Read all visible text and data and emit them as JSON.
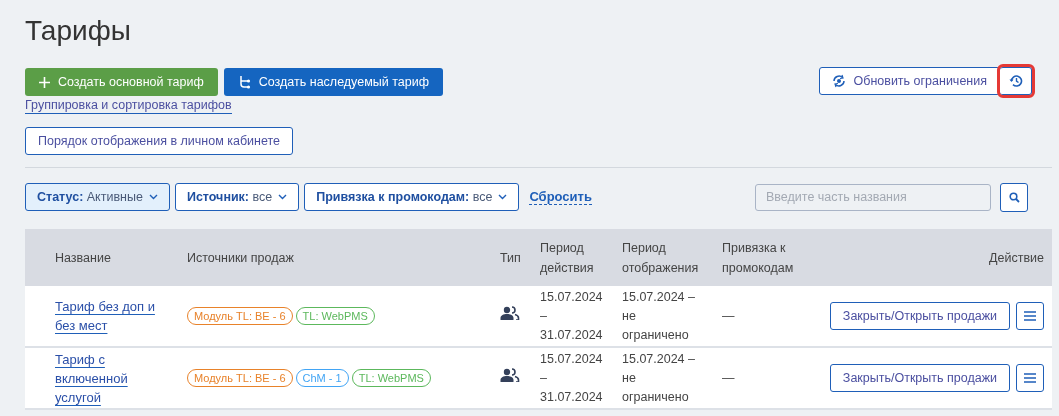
{
  "title": "Тарифы",
  "primary_buttons": [
    {
      "label": "Создать основной тариф",
      "kind": "plus"
    },
    {
      "label": "Создать наследуемый тариф",
      "kind": "branch"
    }
  ],
  "grouping_link": "Группировка и сортировка тарифов",
  "order_button": "Порядок отображения в личном кабинете",
  "refresh_button": "Обновить ограничения",
  "history_button": {
    "highlighted": true
  },
  "filters": [
    {
      "label": "Статус:",
      "value": "Активные",
      "selected": true
    },
    {
      "label": "Источник:",
      "value": "все",
      "selected": false
    },
    {
      "label": "Привязка к промокодам:",
      "value": "все",
      "selected": false
    }
  ],
  "reset_link": "Сбросить",
  "search": {
    "placeholder": "Введите часть названия"
  },
  "table": {
    "columns": [
      "Название",
      "Источники продаж",
      "Тип",
      "Период действия",
      "Период отображения",
      "Привязка к промокодам",
      "Действие"
    ],
    "rows": [
      {
        "name": "Тариф без доп и без мест",
        "sources": [
          {
            "label": "Модуль TL: BE - 6",
            "color": "#e8822a"
          },
          {
            "label": "TL: WebPMS",
            "color": "#5cb85c"
          }
        ],
        "period": "15.07.2024 – 31.07.2024",
        "display": "15.07.2024 – не ограничено",
        "promo": "—",
        "action": "Закрыть/Открыть продажи"
      },
      {
        "name": "Тариф с включенной услугой",
        "sources": [
          {
            "label": "Модуль TL: BE - 6",
            "color": "#e8822a"
          },
          {
            "label": "ChM - 1",
            "color": "#42a5f5"
          },
          {
            "label": "TL: WebPMS",
            "color": "#5cb85c"
          }
        ],
        "period": "15.07.2024 – 31.07.2024",
        "display": "15.07.2024 – не ограничено",
        "promo": "—",
        "action": "Закрыть/Открыть продажи"
      }
    ]
  }
}
